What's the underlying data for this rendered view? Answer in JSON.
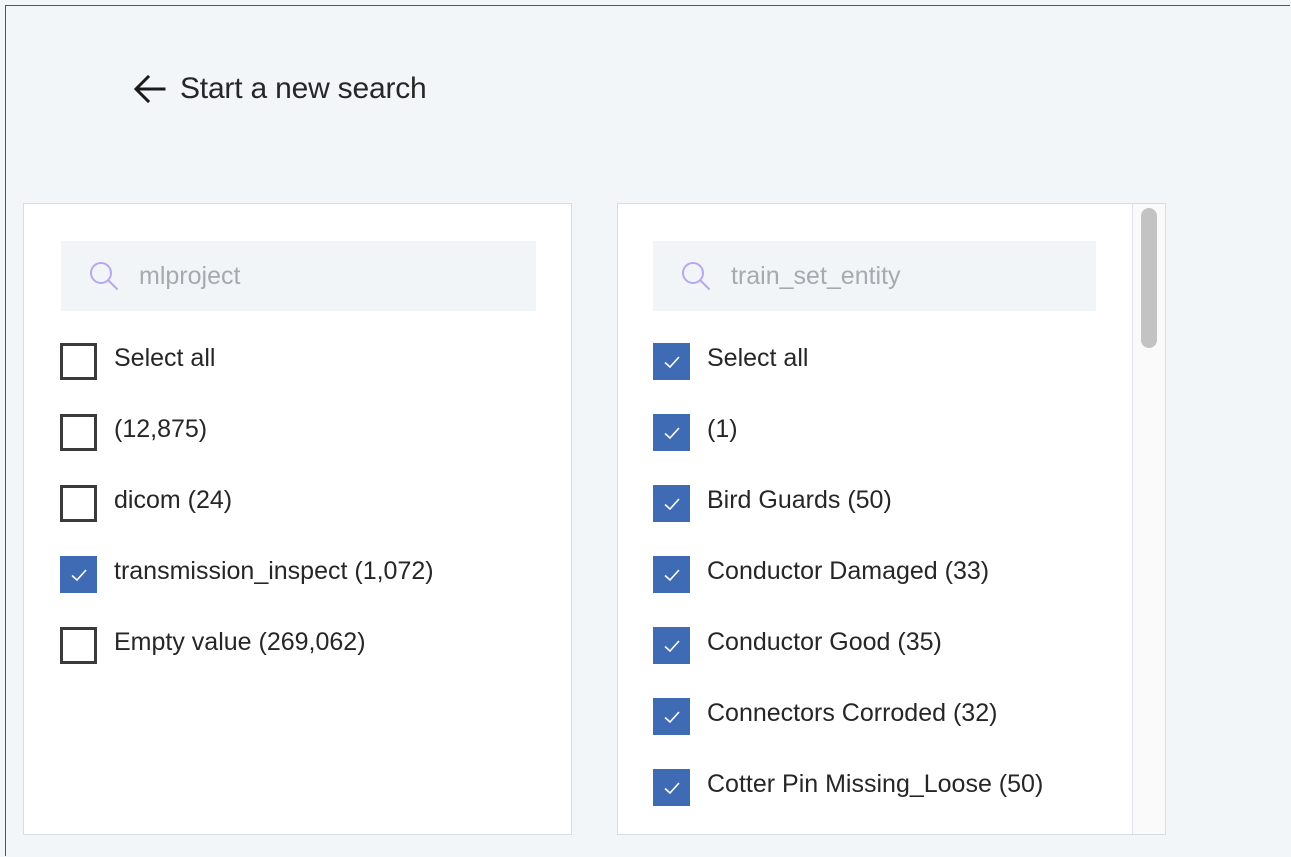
{
  "back_link": {
    "label": "Start a new search",
    "icon": "arrow-left-icon"
  },
  "left_panel": {
    "search": {
      "placeholder": "mlproject",
      "value": ""
    },
    "options": [
      {
        "label": "Select all",
        "checked": false
      },
      {
        "label": "(12,875)",
        "checked": false
      },
      {
        "label": "dicom (24)",
        "checked": false
      },
      {
        "label": "transmission_inspect (1,072)",
        "checked": true
      },
      {
        "label": "Empty value (269,062)",
        "checked": false
      }
    ]
  },
  "right_panel": {
    "search": {
      "placeholder": "train_set_entity",
      "value": ""
    },
    "options": [
      {
        "label": "Select all",
        "checked": true
      },
      {
        "label": "(1)",
        "checked": true
      },
      {
        "label": "Bird Guards (50)",
        "checked": true
      },
      {
        "label": "Conductor Damaged (33)",
        "checked": true
      },
      {
        "label": "Conductor Good (35)",
        "checked": true
      },
      {
        "label": "Connectors Corroded (32)",
        "checked": true
      },
      {
        "label": "Cotter Pin Missing_Loose (50)",
        "checked": true
      }
    ]
  },
  "colors": {
    "page_background": "#f3f6f9",
    "checkbox_checked": "#3f6ab4",
    "search_icon": "#b9a6f2",
    "placeholder_text": "#a6a9b0"
  }
}
